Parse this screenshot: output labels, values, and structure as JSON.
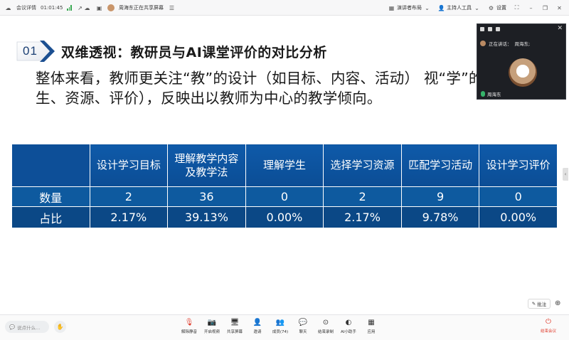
{
  "topbar": {
    "meeting_details": "会议详情",
    "timer": "01:01:45",
    "share_status": "周海东正在共享屏幕",
    "layout_label": "演讲者布局",
    "host_tools_label": "主持人工具",
    "settings_label": "设置"
  },
  "slide": {
    "number": "01",
    "title": "双维透视：教研员与AI课堂评价的对比分析",
    "summary": "整体来看，教师更关注“教”的设计（如目标、内容、活动）                        视“学”的维度（学生、资源、评价），反映出以教师为中心的教学倾向。",
    "accent_color": "#0e5a9f"
  },
  "table": {
    "headers": [
      "",
      "设计学习目标",
      "理解教学内容及教学法",
      "理解学生",
      "选择学习资源",
      "匹配学习活动",
      "设计学习评价"
    ],
    "rows": [
      {
        "label": "数量",
        "values": [
          "2",
          "36",
          "0",
          "2",
          "9",
          "0"
        ]
      },
      {
        "label": "占比",
        "values": [
          "2.17%",
          "39.13%",
          "0.00%",
          "2.17%",
          "9.78%",
          "0.00%"
        ]
      }
    ]
  },
  "video": {
    "speaking_label": "正在讲话：",
    "speaking_name": "周海东;",
    "participant_name": "周海东"
  },
  "side": {
    "annotate_label": "批注"
  },
  "bottombar": {
    "chat_placeholder": "说点什么...",
    "tools": [
      {
        "label": "解除静音",
        "icon": "mic-muted-icon"
      },
      {
        "label": "开启视频",
        "icon": "camera-off-icon"
      },
      {
        "label": "共享屏幕",
        "icon": "share-screen-icon"
      },
      {
        "label": "邀请",
        "icon": "invite-icon"
      },
      {
        "label": "成员(74)",
        "icon": "members-icon"
      },
      {
        "label": "聊天",
        "icon": "chat-icon"
      },
      {
        "label": "结束录制",
        "icon": "record-icon"
      },
      {
        "label": "AI小助手",
        "icon": "ai-assistant-icon"
      },
      {
        "label": "应用",
        "icon": "apps-icon"
      }
    ],
    "end_label": "结束会议"
  }
}
